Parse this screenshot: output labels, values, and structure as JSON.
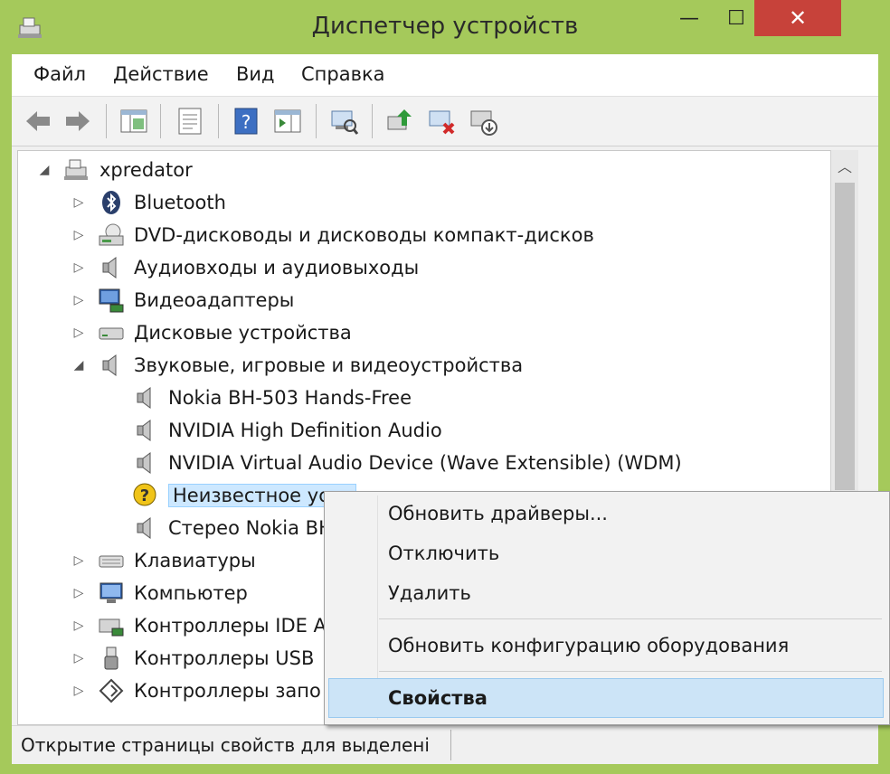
{
  "window": {
    "title": "Диспетчер устройств",
    "controls": {
      "minimize": "—",
      "maximize": "☐",
      "close": "✕"
    }
  },
  "menubar": {
    "items": [
      "Файл",
      "Действие",
      "Вид",
      "Справка"
    ]
  },
  "toolbar": {
    "buttons": [
      "back-icon",
      "forward-icon",
      "show-hide-console-tree-icon",
      "properties-icon",
      "help-icon",
      "action-pane-icon",
      "scan-hardware-icon",
      "update-driver-icon",
      "disable-device-icon",
      "uninstall-device-icon"
    ]
  },
  "tree": {
    "root": "xpredator",
    "categories": {
      "bluetooth": "Bluetooth",
      "dvd": "DVD-дисководы и дисководы компакт-дисков",
      "audio_io": "Аудиовходы и аудиовыходы",
      "video": "Видеоадаптеры",
      "disk": "Дисковые устройства",
      "sound": "Звуковые, игровые и видеоустройства",
      "keyboards": "Клавиатуры",
      "computer": "Компьютер",
      "ide": "Контроллеры IDE A",
      "usb": "Контроллеры USB",
      "storage": "Контроллеры запо"
    },
    "sound_children": {
      "nokia_hf": "Nokia BH-503 Hands-Free",
      "nvidia_hda": "NVIDIA High Definition Audio",
      "nvidia_virtual": "NVIDIA Virtual Audio Device (Wave Extensible) (WDM)",
      "unknown": "Неизвестное устр",
      "stereo_nokia": "Стерео Nokia BH"
    },
    "expander_collapsed": "▷",
    "expander_expanded": "◢"
  },
  "context_menu": {
    "update_drivers": "Обновить драйверы...",
    "disable": "Отключить",
    "uninstall": "Удалить",
    "scan": "Обновить конфигурацию оборудования",
    "properties": "Свойства"
  },
  "status": {
    "text": "Открытие страницы свойств для выделенi"
  },
  "colors": {
    "frame": "#a5c95b",
    "close": "#c7423a",
    "selection": "#cde8ff",
    "menu_highlight": "#cce4f7"
  }
}
